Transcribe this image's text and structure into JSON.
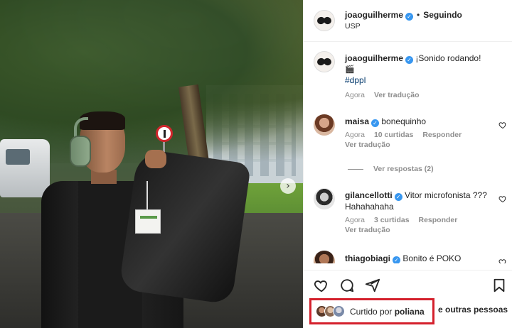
{
  "post": {
    "author": "joaoguilherme",
    "follow_status": "Seguindo",
    "location": "USP",
    "caption": "¡Sonido rodando!",
    "caption_emoji": "🎬",
    "hashtag": "#dppl",
    "time": "Agora",
    "translate": "Ver tradução"
  },
  "comments": [
    {
      "user": "maisa",
      "text": "bonequinho",
      "time": "Agora",
      "likes": "10 curtidas",
      "reply": "Responder",
      "translate": "Ver tradução",
      "view_replies": "Ver respostas (2)"
    },
    {
      "user": "gilancellotti",
      "text": "Vitor microfonista ??? Hahahahaha",
      "time": "Agora",
      "likes": "3 curtidas",
      "reply": "Responder",
      "translate": "Ver tradução"
    },
    {
      "user": "thiagobiagi",
      "text": "Bonito é POKO"
    }
  ],
  "likes": {
    "prefix": "Curtido por",
    "user": "poliana",
    "suffix": "e outras pessoas"
  },
  "colors": {
    "highlight_box": "#d4202c",
    "verified": "#3897f0",
    "hashtag": "#00376b"
  },
  "icons": [
    "verified-icon",
    "heart-icon",
    "comment-icon",
    "share-icon",
    "save-icon",
    "chevron-right-icon"
  ]
}
